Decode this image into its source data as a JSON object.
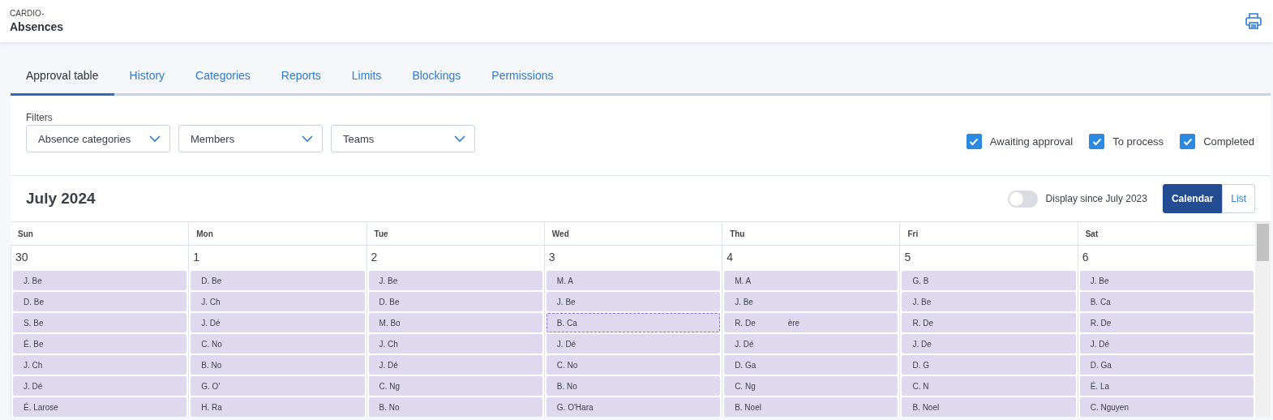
{
  "header": {
    "org": "CARDIO-",
    "title": "Absences"
  },
  "tabs": [
    {
      "label": "Approval table",
      "selected": true
    },
    {
      "label": "History",
      "selected": false
    },
    {
      "label": "Categories",
      "selected": false
    },
    {
      "label": "Reports",
      "selected": false
    },
    {
      "label": "Limits",
      "selected": false
    },
    {
      "label": "Blockings",
      "selected": false
    },
    {
      "label": "Permissions",
      "selected": false
    }
  ],
  "filters": {
    "label": "Filters",
    "dropdowns": [
      "Absence categories",
      "Members",
      "Teams"
    ],
    "statuses": [
      {
        "label": "Awaiting approval",
        "checked": true
      },
      {
        "label": "To process",
        "checked": true
      },
      {
        "label": "Completed",
        "checked": true
      }
    ]
  },
  "calendar": {
    "month": "July 2024",
    "since_toggle": {
      "label": "Display since July 2023",
      "on": false
    },
    "views": [
      {
        "label": "Calendar",
        "selected": true
      },
      {
        "label": "List",
        "selected": false
      }
    ],
    "weekdays": [
      "Sun",
      "Mon",
      "Tue",
      "Wed",
      "Thu",
      "Fri",
      "Sat"
    ],
    "days": [
      {
        "date": "30",
        "entries": [
          {
            "name": "J. Be",
            "selected": false
          },
          {
            "name": "D. Be",
            "selected": false
          },
          {
            "name": "S. Be",
            "selected": false
          },
          {
            "name": "É. Be",
            "selected": false
          },
          {
            "name": "J. Ch",
            "selected": false
          },
          {
            "name": "J. Dé",
            "selected": false
          },
          {
            "name": "É. Larose",
            "selected": false
          }
        ]
      },
      {
        "date": "1",
        "entries": [
          {
            "name": "D. Be",
            "selected": false
          },
          {
            "name": "J. Ch",
            "selected": false
          },
          {
            "name": "J. Dé",
            "selected": false
          },
          {
            "name": "C. No",
            "selected": false
          },
          {
            "name": "B. No",
            "selected": false
          },
          {
            "name": "G. O'",
            "selected": false
          },
          {
            "name": "H. Ra",
            "selected": false
          }
        ]
      },
      {
        "date": "2",
        "entries": [
          {
            "name": "J. Be",
            "selected": false
          },
          {
            "name": "D. Be",
            "selected": false
          },
          {
            "name": "M. Bo",
            "selected": false
          },
          {
            "name": "J. Ch",
            "selected": false
          },
          {
            "name": "J. Dé",
            "selected": false
          },
          {
            "name": "C. Ng",
            "selected": false
          },
          {
            "name": "B. No",
            "selected": false
          }
        ]
      },
      {
        "date": "3",
        "entries": [
          {
            "name": "M. A",
            "selected": false
          },
          {
            "name": "J. Be",
            "selected": false
          },
          {
            "name": "B. Ca",
            "selected": true
          },
          {
            "name": "J. Dé",
            "selected": false
          },
          {
            "name": "C. No",
            "selected": false
          },
          {
            "name": "B. No",
            "selected": false
          },
          {
            "name": "G. O'Hara",
            "selected": false
          }
        ]
      },
      {
        "date": "4",
        "entries": [
          {
            "name": "M. A",
            "selected": false
          },
          {
            "name": "J. Be",
            "selected": false
          },
          {
            "name": "R. De",
            "name_end": "ère",
            "selected": false
          },
          {
            "name": "J. Dé",
            "selected": false
          },
          {
            "name": "D. Ga",
            "selected": false
          },
          {
            "name": "C. Ng",
            "selected": false
          },
          {
            "name": "B. Noel",
            "selected": false
          }
        ]
      },
      {
        "date": "5",
        "entries": [
          {
            "name": "G. B",
            "selected": false
          },
          {
            "name": "J. Be",
            "selected": false
          },
          {
            "name": "R. De",
            "selected": false
          },
          {
            "name": "J. De",
            "selected": false
          },
          {
            "name": "D. G",
            "selected": false
          },
          {
            "name": "C. N",
            "selected": false
          },
          {
            "name": "B. Noel",
            "selected": false
          }
        ]
      },
      {
        "date": "6",
        "entries": [
          {
            "name": "J. Be",
            "selected": false
          },
          {
            "name": "B. Ca",
            "selected": false
          },
          {
            "name": "R. De",
            "selected": false
          },
          {
            "name": "J. Dé",
            "selected": false
          },
          {
            "name": "D. Ga",
            "selected": false
          },
          {
            "name": "É. La",
            "selected": false
          },
          {
            "name": "C. Nguyen",
            "selected": false
          }
        ]
      }
    ]
  }
}
